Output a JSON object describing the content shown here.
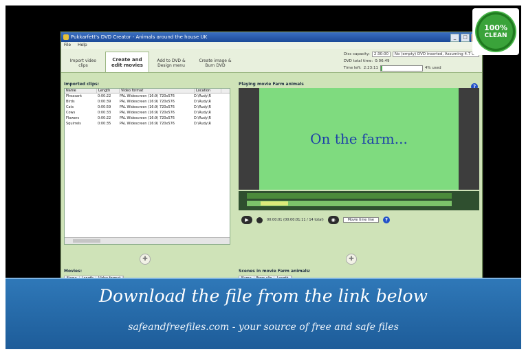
{
  "window": {
    "title": "Pukkarfett's DVD Creator - Animals around the house UK",
    "buttons": [
      "_",
      "□",
      "×"
    ]
  },
  "menu": [
    "File",
    "Help"
  ],
  "tabs": [
    {
      "label": "Import video clips",
      "active": false
    },
    {
      "label": "Create and edit movies",
      "active": true
    },
    {
      "label": "Add to DVD & Design menu",
      "active": false
    },
    {
      "label": "Create image & Burn DVD",
      "active": false
    }
  ],
  "disc": {
    "capacity_label": "Disc capacity:",
    "capacity_value": "2:30:00",
    "capacity_note": "No (empty) DVD inserted, Assuming 4.7 GB",
    "total_label": "DVD total time:",
    "total_value": "0:06:49",
    "left_label": "Time left:",
    "left_value": "2:23:11",
    "used_text": "4% used",
    "used_fraction": 0.04
  },
  "imported": {
    "title": "Imported clips:",
    "columns": [
      "Name",
      "Length",
      "Video format",
      "Location"
    ],
    "rows": [
      [
        "Pheasant",
        "0:00:22",
        "PAL Widescreen (16:9) 720x576",
        "D:\\Rudy\\R"
      ],
      [
        "Birds",
        "0:00:39",
        "PAL Widescreen (16:9) 720x576",
        "D:\\Rudy\\R"
      ],
      [
        "Cats",
        "0:00:59",
        "PAL Widescreen (16:9) 720x576",
        "D:\\Rudy\\R"
      ],
      [
        "Cows",
        "0:00:33",
        "PAL Widescreen (16:9) 720x576",
        "D:\\Rudy\\R"
      ],
      [
        "Flowers",
        "0:00:22",
        "PAL Widescreen (16:9) 720x576",
        "D:\\Rudy\\R"
      ],
      [
        "Squirrels",
        "0:00:35",
        "PAL Widescreen (16:9) 720x576",
        "D:\\Rudy\\R"
      ]
    ]
  },
  "player": {
    "title": "Playing movie Farm animals",
    "screen_text": "On the farm...",
    "time_text": "00:00:01 (00:00:01:11 / 14 total)",
    "mode": "Movie time line"
  },
  "movies": {
    "title": "Movies:",
    "columns": [
      "Name",
      "Length",
      "Video format"
    ]
  },
  "scenes": {
    "title": "Scenes in movie Farm animals:",
    "columns": [
      "Name",
      "From clip",
      "Length"
    ]
  },
  "banner": {
    "title": "Download the file from the link below",
    "subtitle": "safeandfreefiles.com - your source of free and safe files"
  },
  "badge": {
    "percent": "100%",
    "word": "CLEAN"
  },
  "colors": {
    "banner": "#2f78b8",
    "screen": "#7fdb7f",
    "screen_text": "#1c3fa8",
    "badge": "#3aa33a"
  }
}
